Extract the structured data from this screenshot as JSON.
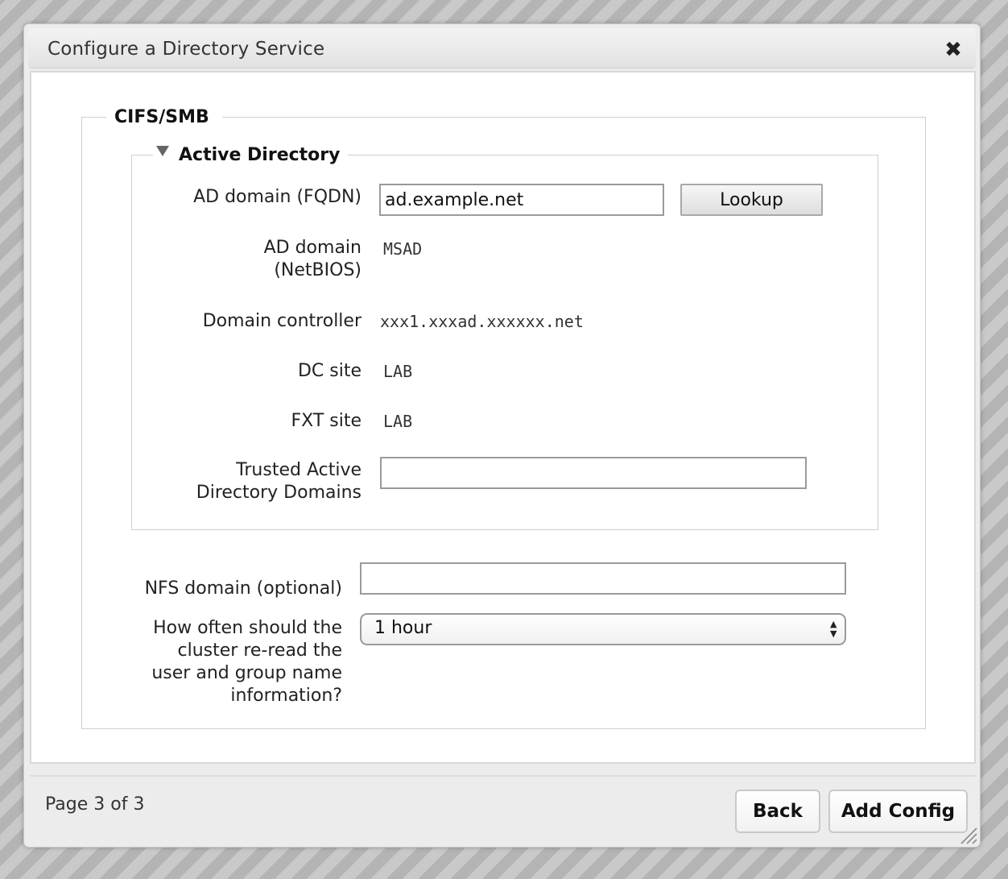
{
  "dialog": {
    "title": "Configure a Directory Service",
    "close_icon": "close-icon"
  },
  "cifs": {
    "legend": "CIFS/SMB",
    "active_directory": {
      "legend": "Active Directory",
      "ad_domain_fqdn": {
        "label": "AD domain (FQDN)",
        "value": "ad.example.net"
      },
      "lookup_label": "Lookup",
      "ad_domain_netbios": {
        "label_line1": "AD domain",
        "label_line2": "(NetBIOS)",
        "value": "MSAD"
      },
      "domain_controller": {
        "label": "Domain controller",
        "value": "xxx1.xxxad.xxxxxx.net"
      },
      "dc_site": {
        "label": "DC site",
        "value": "LAB"
      },
      "fxt_site": {
        "label": "FXT site",
        "value": "LAB"
      },
      "trusted_domains": {
        "label_line1": "Trusted Active",
        "label_line2": "Directory Domains",
        "value": ""
      }
    },
    "nfs_domain": {
      "label": "NFS domain (optional)",
      "value": ""
    },
    "refresh": {
      "label_lines": [
        "How often should the",
        "cluster re-read the",
        "user and group name",
        "information?"
      ],
      "selected": "1 hour"
    }
  },
  "footer": {
    "page": "Page 3 of 3",
    "back_label": "Back",
    "add_label": "Add Config"
  }
}
